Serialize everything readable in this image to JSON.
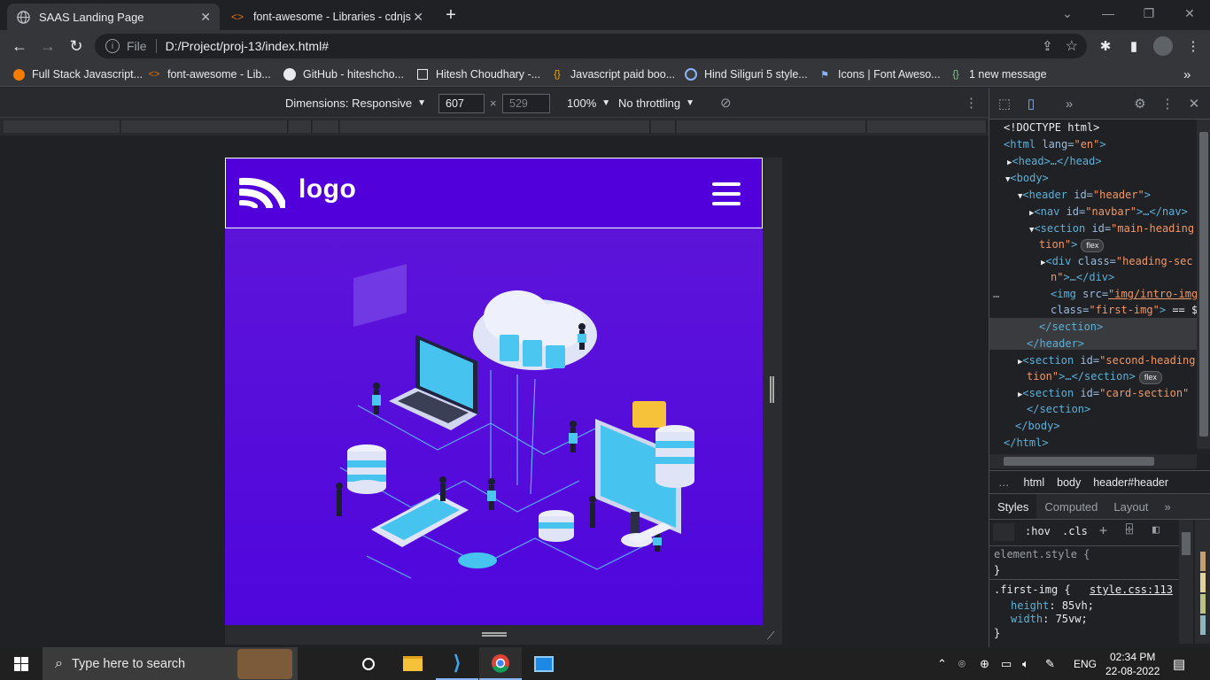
{
  "browser": {
    "tabs": [
      {
        "title": "SAAS Landing Page",
        "active": true,
        "icon": "globe-icon"
      },
      {
        "title": "font-awesome - Libraries - cdnjs",
        "active": false,
        "icon": "code-brackets-icon"
      }
    ],
    "new_tab": "+",
    "address": {
      "scheme_label": "File",
      "url": "D:/Project/proj-13/index.html#"
    },
    "bookmarks": [
      {
        "label": "Full Stack Javascript...",
        "icon": "circle-orange-icon"
      },
      {
        "label": "font-awesome - Lib...",
        "icon": "code-brackets-icon"
      },
      {
        "label": "GitHub - hiteshcho...",
        "icon": "github-icon"
      },
      {
        "label": "Hitesh Choudhary -...",
        "icon": "square-icon"
      },
      {
        "label": "Javascript paid boo...",
        "icon": "braces-icon"
      },
      {
        "label": "Hind Siliguri 5 style...",
        "icon": "google-fonts-icon"
      },
      {
        "label": "Icons | Font Aweso...",
        "icon": "flag-icon"
      },
      {
        "label": "1 new message",
        "icon": "braces-green-icon"
      }
    ]
  },
  "device_toolbar": {
    "dimensions_label": "Dimensions: Responsive",
    "width": "607",
    "times": "×",
    "height": "529",
    "zoom": "100%",
    "throttling": "No throttling"
  },
  "page": {
    "logo_text": "logo"
  },
  "devtools": {
    "dom": {
      "doctype": "<!DOCTYPE html>",
      "html_open": "<html",
      "lang_attr": "lang=",
      "lang_val": "\"en\"",
      "head": "<head>…</head>",
      "body_open": "<body>",
      "header_open": "<header",
      "header_id": "id=",
      "header_id_val": "\"header\"",
      "nav_line": "<nav",
      "nav_id": "id=",
      "nav_id_val": "\"navbar\"",
      "nav_end": ">…</nav>",
      "section_open": "<section",
      "section_id": "id=",
      "section_id_val": "\"main-heading",
      "section_id_cont": "tion\"",
      "flex_badge": "flex",
      "div_open": "<div",
      "div_class": "class=",
      "div_class_val": "\"heading-sec",
      "div_cont": "n\"",
      "div_end": ">…</div>",
      "img_open": "<img",
      "img_src": "src=",
      "img_src_val": "\"img/intro-img",
      "img_class": "class=",
      "img_class_val": "\"first-img\"",
      "img_eq": "== $",
      "section_close": "</section>",
      "header_close": "</header>",
      "section2_id_val": "\"second-heading",
      "section2_cont": "tion\"",
      "section2_end": ">…</section>",
      "section3_id_val": "\"card-section\"",
      "section3_close": "</section>",
      "body_close": "</body>",
      "html_close": "</html>",
      "ellipsis": "…"
    },
    "breadcrumbs": [
      "…",
      "html",
      "body",
      "header#header"
    ],
    "panel_tabs": [
      "Styles",
      "Computed",
      "Layout"
    ],
    "filter_hov": ":hov",
    "filter_cls": ".cls",
    "styles": {
      "element_style": "element.style {",
      "close_brace": "}",
      "rule_selector": ".first-img {",
      "rule_source": "style.css:113",
      "prop1_name": "height",
      "prop1_value": "85vh;",
      "prop2_name": "width",
      "prop2_value": "75vw;"
    }
  },
  "taskbar": {
    "search_placeholder": "Type here to search",
    "language": "ENG",
    "time": "02:34 PM",
    "date": "22-08-2022"
  },
  "colors": {
    "page_purple": "#5000e0",
    "accent_blue": "#5db0d7",
    "attr_orange": "#f29766"
  }
}
